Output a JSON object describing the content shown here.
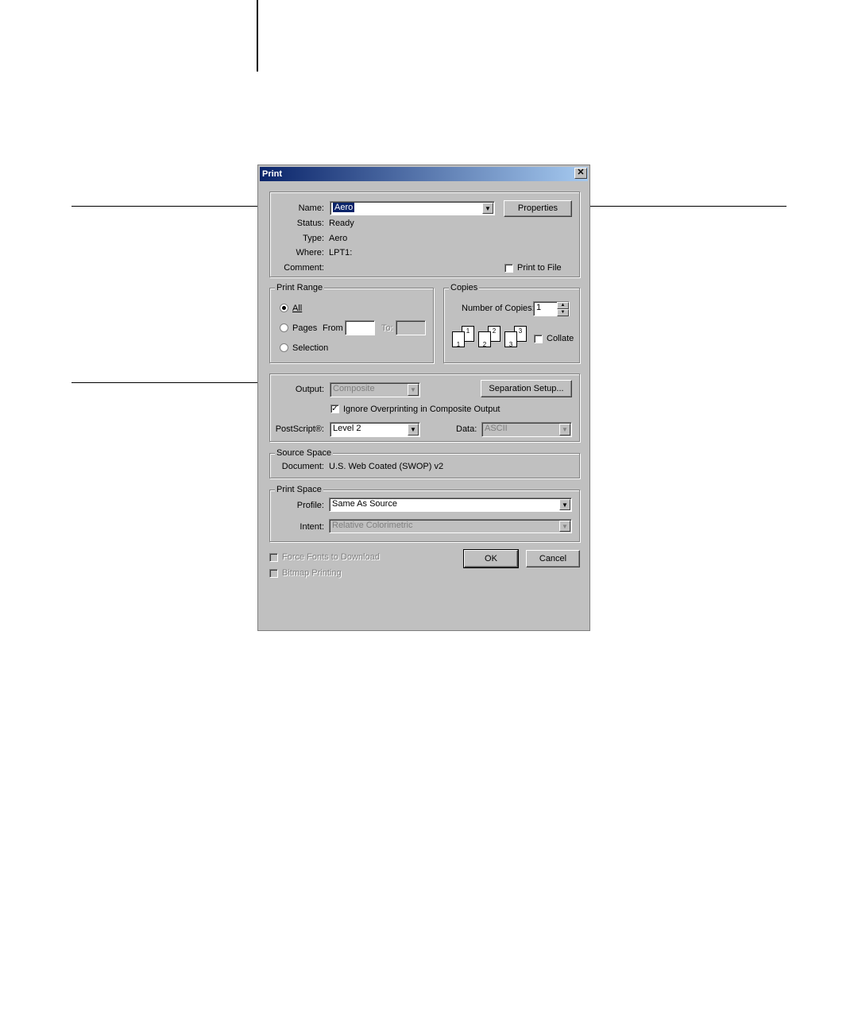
{
  "dialog": {
    "title": "Print",
    "close_glyph": "✕"
  },
  "printer": {
    "name_label": "Name:",
    "name_value": "Aero",
    "properties_label": "Properties",
    "status_label": "Status:",
    "status_value": "Ready",
    "type_label": "Type:",
    "type_value": "Aero",
    "where_label": "Where:",
    "where_value": "LPT1:",
    "comment_label": "Comment:",
    "print_to_file_label": "Print to File"
  },
  "print_range": {
    "title": "Print Range",
    "all_label": "All",
    "pages_label": "Pages",
    "from_label": "From",
    "to_label": "To:",
    "selection_label": "Selection"
  },
  "copies": {
    "title": "Copies",
    "number_label": "Number of Copies:",
    "number_value": "1",
    "collate_label": "Collate",
    "page_numbers": [
      "1",
      "1",
      "2",
      "2",
      "3",
      "3"
    ]
  },
  "output": {
    "output_label": "Output:",
    "output_value": "Composite",
    "separation_setup_label": "Separation Setup...",
    "ignore_overprinting_label": "Ignore Overprinting in Composite Output",
    "postscript_label": "PostScript®:",
    "postscript_value": "Level 2",
    "data_label": "Data:",
    "data_value": "ASCII"
  },
  "source_space": {
    "title": "Source Space",
    "document_label": "Document:",
    "document_value": "U.S. Web Coated (SWOP) v2"
  },
  "print_space": {
    "title": "Print Space",
    "profile_label": "Profile:",
    "profile_value": "Same As Source",
    "intent_label": "Intent:",
    "intent_value": "Relative Colorimetric"
  },
  "options": {
    "force_fonts_label": "Force Fonts to Download",
    "bitmap_printing_label": "Bitmap Printing"
  },
  "buttons": {
    "ok_label": "OK",
    "cancel_label": "Cancel"
  },
  "glyphs": {
    "check": "✓",
    "down": "▼",
    "up_small": "▲",
    "down_small": "▼"
  }
}
